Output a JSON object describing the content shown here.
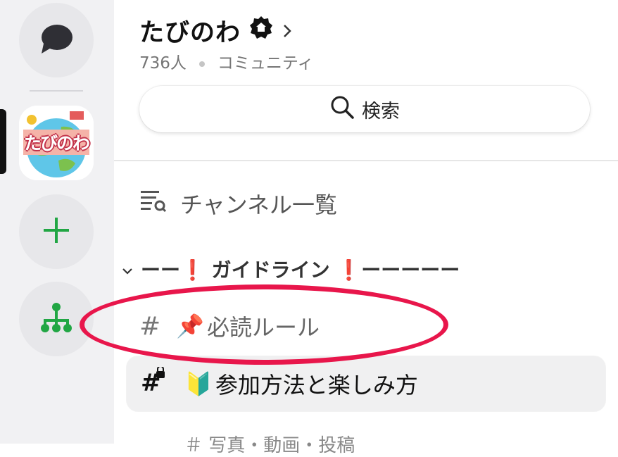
{
  "rail": {
    "items": [
      {
        "name": "messages-icon"
      },
      {
        "name": "server-tabinowa",
        "label": "たびのわ"
      },
      {
        "name": "add-server-icon"
      },
      {
        "name": "hierarchy-icon"
      }
    ]
  },
  "community": {
    "name": "たびのわ",
    "member_count": "736人",
    "type": "コミュニティ"
  },
  "search": {
    "label": "検索"
  },
  "channel_list": {
    "label": "チャンネル一覧"
  },
  "category": {
    "name": "ーー❗ ガイドライン ❗ーーーーー"
  },
  "channels": [
    {
      "prefix": "#",
      "emoji": "📌",
      "name": "必読ルール",
      "selected": false
    },
    {
      "prefix": "#",
      "emoji": "🔰",
      "name": "参加方法と楽しみ方",
      "selected": true,
      "locked": true
    }
  ],
  "faded_text": "＃ 写真・動画・投稿",
  "colors": {
    "rail_bg": "#f1f1f3",
    "accent_green": "#21a644",
    "highlight_red": "#e8164b",
    "selected_bg": "#f0f0f1"
  }
}
